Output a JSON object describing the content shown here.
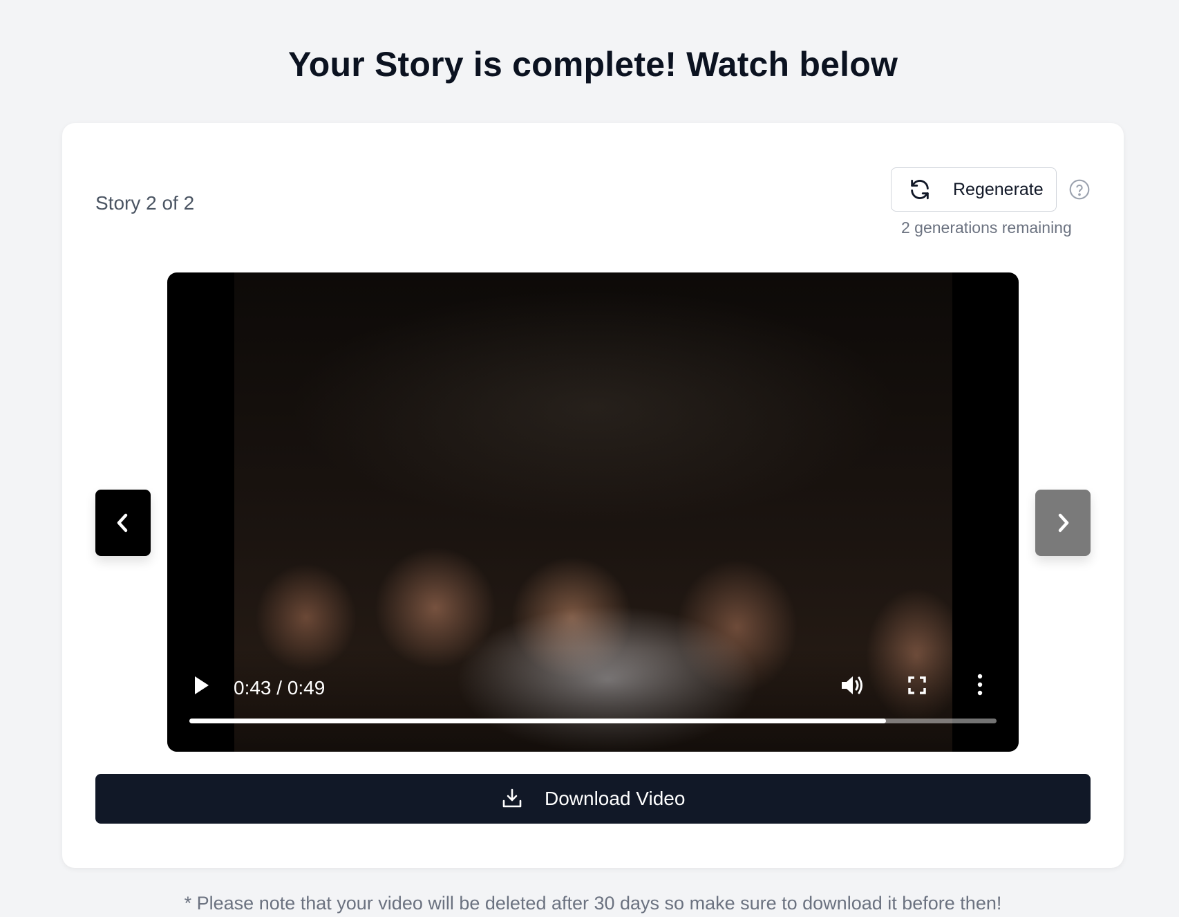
{
  "page": {
    "title": "Your Story is complete! Watch below",
    "footnote": "* Please note that your video will be deleted after 30 days so make sure to download it before then!"
  },
  "card": {
    "story_counter": "Story 2 of 2",
    "regenerate": {
      "label": "Regenerate",
      "icon": "refresh-icon",
      "remaining": "2 generations remaining"
    },
    "help_icon": "question-circle-icon",
    "video": {
      "time_display": "0:43 / 0:49",
      "progress_fraction": 0.863,
      "icons": [
        "play-icon",
        "volume-icon",
        "fullscreen-icon",
        "more-vertical-icon"
      ]
    },
    "nav": {
      "prev_icon": "chevron-left-icon",
      "next_icon": "chevron-right-icon"
    },
    "download": {
      "label": "Download Video",
      "icon": "download-icon"
    }
  },
  "colors": {
    "background": "#f3f4f6",
    "card": "#ffffff",
    "primary_button": "#111827",
    "nav_prev": "#000000",
    "nav_next_disabled": "#7a7a7a"
  }
}
